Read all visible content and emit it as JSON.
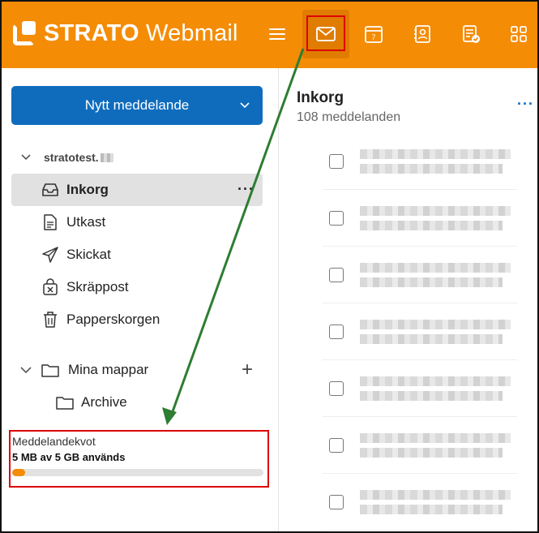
{
  "header": {
    "brand_bold": "STRATO",
    "brand_light": "Webmail",
    "icons": [
      "menu-icon",
      "mail-icon",
      "calendar-icon",
      "contacts-icon",
      "tasks-icon",
      "apps-icon"
    ],
    "calendar_day": "7",
    "colors": {
      "bar": "#f48c06",
      "active": "#e07c00",
      "highlight": "#dd0000"
    }
  },
  "sidebar": {
    "new_message_label": "Nytt meddelande",
    "account": "stratotest.",
    "folders": [
      {
        "label": "Inkorg",
        "icon": "inbox-icon",
        "active": true
      },
      {
        "label": "Utkast",
        "icon": "draft-icon"
      },
      {
        "label": "Skickat",
        "icon": "send-icon"
      },
      {
        "label": "Skräppost",
        "icon": "junk-icon"
      },
      {
        "label": "Papperskorgen",
        "icon": "trash-icon"
      }
    ],
    "my_folders_label": "Mina mappar",
    "archive_label": "Archive"
  },
  "quota": {
    "title": "Meddelandekvot",
    "used_text": "5 MB av 5 GB används",
    "fill_fraction": 0.05
  },
  "inbox": {
    "title": "Inkorg",
    "count_text": "108 meddelanden",
    "rows": 7
  },
  "colors": {
    "primary_button": "#0f6cbd",
    "arrow": "#2e7d32"
  }
}
